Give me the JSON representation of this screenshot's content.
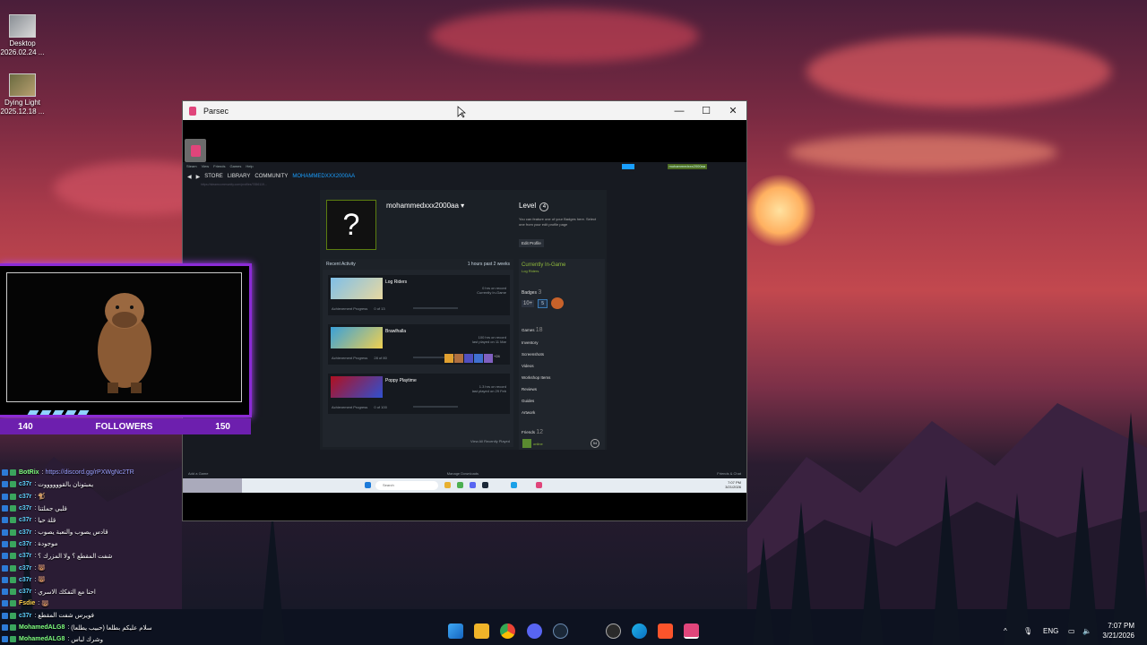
{
  "desktop": {
    "icons": [
      {
        "label": "Desktop",
        "sublabel": "2026.02.24 ..."
      },
      {
        "label": "Dying Light",
        "sublabel": "2025.12.18 ..."
      }
    ]
  },
  "window": {
    "title": "Parsec",
    "minimize": "—",
    "maximize": "☐",
    "close": "✕"
  },
  "steam": {
    "menu": [
      "Steam",
      "View",
      "Friends",
      "Games",
      "Help"
    ],
    "nav": [
      "STORE",
      "LIBRARY",
      "COMMUNITY"
    ],
    "nav_active": "MOHAMMEDXXX2000AA",
    "username_badge": "mohammedxxx2000aa",
    "url": "https://steamcommunity.com/profiles/7656119...",
    "profile": {
      "avatar_glyph": "?",
      "name": "mohammedxxx2000aa ▾",
      "level_label": "Level",
      "level": "4",
      "level_note": "You can feature one of your Badges here. Select one from your edit profile page",
      "edit_button": "Edit Profile"
    },
    "recent_activity": {
      "title": "Recent Activity",
      "summary": "1 hours past 2 weeks",
      "games": [
        {
          "name": "Log Riders",
          "stats": [
            "0 hrs on record",
            "Currently In-Game"
          ],
          "progress_label": "Achievement Progress",
          "progress_text": "0 of 13"
        },
        {
          "name": "Brawlhalla",
          "stats": [
            "100 hrs on record",
            "last played on 11 Mar"
          ],
          "progress_label": "Achievement Progress",
          "progress_text": "28 of 80",
          "more": "+24"
        },
        {
          "name": "Poppy Playtime",
          "stats": [
            "1.3 hrs on record",
            "last played on 29 Feb"
          ],
          "progress_label": "Achievement Progress",
          "progress_text": "0 of 100"
        }
      ],
      "view_all": "View  All Recently Played"
    },
    "sidebar": {
      "in_game": "Currently In-Game",
      "in_game_title": "Log Riders",
      "badges_label": "Badges",
      "badges_count": "3",
      "badge_values": [
        "10+",
        "5"
      ],
      "games_label": "Games",
      "games_count": "18",
      "links": [
        "Inventory",
        "Screenshots",
        "Videos",
        "Workshop Items",
        "Reviews",
        "Guides",
        "Artwork"
      ],
      "friends_label": "Friends",
      "friends_count": "12",
      "friend_online": "online",
      "friend_count_badge": "54"
    },
    "footer": {
      "left": "Add a Game",
      "center": "Manage Downloads",
      "right": "Friends & Chat"
    }
  },
  "remote_taskbar": {
    "search": "Search",
    "time": "7:07 PM",
    "date": "3/21/2026"
  },
  "stream": {
    "followers_left": "140",
    "followers_label": "FOLLOWERS",
    "followers_right": "150"
  },
  "chat": [
    {
      "name": "BotRix",
      "text": "https://discord.gg/rPXWgNc2TR",
      "link": true
    },
    {
      "name": "c37r",
      "text": "يمبتونان بالقووووووت"
    },
    {
      "name": "c37r",
      "text": "🐒"
    },
    {
      "name": "c37r",
      "text": "قلبي جملتنا"
    },
    {
      "name": "c37r",
      "text": "قلة حيا"
    },
    {
      "name": "c37r",
      "text": "قادس يصوب والنعبة يصوب"
    },
    {
      "name": "c37r",
      "text": "موجودة"
    },
    {
      "name": "c37r",
      "text": "شفت المقطع ؟ ولا المزرك ؟"
    },
    {
      "name": "c37r",
      "text": "🐻"
    },
    {
      "name": "c37r",
      "text": "🐻"
    },
    {
      "name": "c37r",
      "text": "احنا مع التفكك الاسري"
    },
    {
      "name": "Fsdie",
      "text": "🐻"
    },
    {
      "name": "c37r",
      "text": "فويرس شفت المقطع"
    },
    {
      "name": "MohamedALG8",
      "text": "سلام عليكم بطلعا (حبيب يطلعا)"
    },
    {
      "name": "MohamedALG8",
      "text": "وشرك لباس"
    }
  ],
  "host_taskbar": {
    "tray_lang": "ENG",
    "time": "7:07 PM",
    "date": "3/21/2026",
    "icons": [
      "windows-start-icon",
      "file-explorer-icon",
      "chrome-icon",
      "discord-icon",
      "steam-icon",
      "obs-icon",
      "edge-icon",
      "brave-icon",
      "parsec-icon"
    ]
  }
}
